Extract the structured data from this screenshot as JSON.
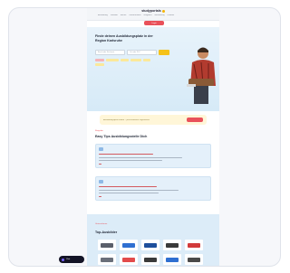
{
  "site": {
    "logo_text": "studyportals"
  },
  "nav": {
    "items": [
      "Ausbildung",
      "Studium",
      "Berufe",
      "Unternehmen",
      "Ratgeber",
      "Bewerbung",
      "Kontakt"
    ],
    "cta_label": "Login"
  },
  "hero": {
    "title": "Finde deinen Ausbildungsplatz in der Region Karlsruhe",
    "search_placeholder": "Beruf oder Stichwort",
    "location_placeholder": "Ort oder PLZ"
  },
  "banner": {
    "text": "Ausbildungsplatz finden – jetzt kostenlos registrieren"
  },
  "tips": {
    "eyebrow": "Ratgeber",
    "title": "Easy Tips Ausbildungsstelle Dich"
  },
  "companies": {
    "eyebrow": "Unternehmen",
    "title": "Top-Ausbilder"
  },
  "chat": {
    "label": "Chat"
  },
  "colors": {
    "accent_red": "#e9515a",
    "accent_yellow": "#f5c21a",
    "hero_blue": "#d6eaf7"
  }
}
